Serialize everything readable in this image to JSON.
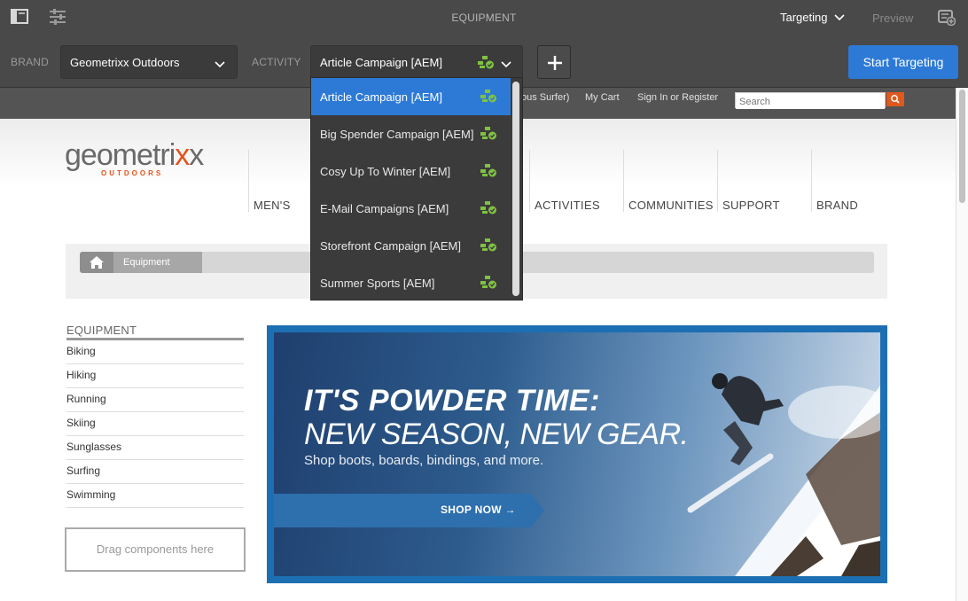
{
  "topbar": {
    "page_title": "EQUIPMENT",
    "mode": "Targeting",
    "preview_label": "Preview"
  },
  "toolbar": {
    "brand_label": "BRAND",
    "brand_value": "Geometrixx Outdoors",
    "activity_label": "ACTIVITY",
    "activity_value": "Article Campaign [AEM]",
    "start_targeting_label": "Start Targeting"
  },
  "activity_dropdown": {
    "items": [
      {
        "label": "Article Campaign [AEM]",
        "selected": true
      },
      {
        "label": "Big Spender Campaign [AEM]",
        "selected": false
      },
      {
        "label": "Cosy Up To Winter [AEM]",
        "selected": false
      },
      {
        "label": "E-Mail Campaigns [AEM]",
        "selected": false
      },
      {
        "label": "Storefront Campaign [AEM]",
        "selected": false
      },
      {
        "label": "Summer Sports [AEM]",
        "selected": false
      }
    ]
  },
  "site": {
    "top_links": {
      "surfer_fragment": "ous Surfer)",
      "cart": "My Cart",
      "signin": "Sign In or Register"
    },
    "search_placeholder": "Search",
    "logo": {
      "main_a": "geometri",
      "main_b": "x",
      "main_c": "x",
      "sub": "OUTDOORS"
    },
    "nav": [
      "MEN'S",
      "ACTIVITIES",
      "COMMUNITIES",
      "SUPPORT",
      "BRAND"
    ],
    "breadcrumb": {
      "current": "Equipment"
    },
    "sidebar": {
      "title": "EQUIPMENT",
      "items": [
        "Biking",
        "Hiking",
        "Running",
        "Skiing",
        "Sunglasses",
        "Surfing",
        "Swimming"
      ]
    },
    "drop_zone_text": "Drag components here",
    "hero": {
      "headline": "IT'S POWDER TIME:",
      "subheadline": "NEW SEASON, NEW GEAR.",
      "body": "Shop boots, boards, bindings, and more.",
      "cta": "SHOP NOW →"
    }
  },
  "colors": {
    "chrome_dark": "#494949",
    "accent_blue": "#2d7ad6",
    "aem_icon_green": "#7fc241",
    "brand_orange": "#e4521b"
  }
}
